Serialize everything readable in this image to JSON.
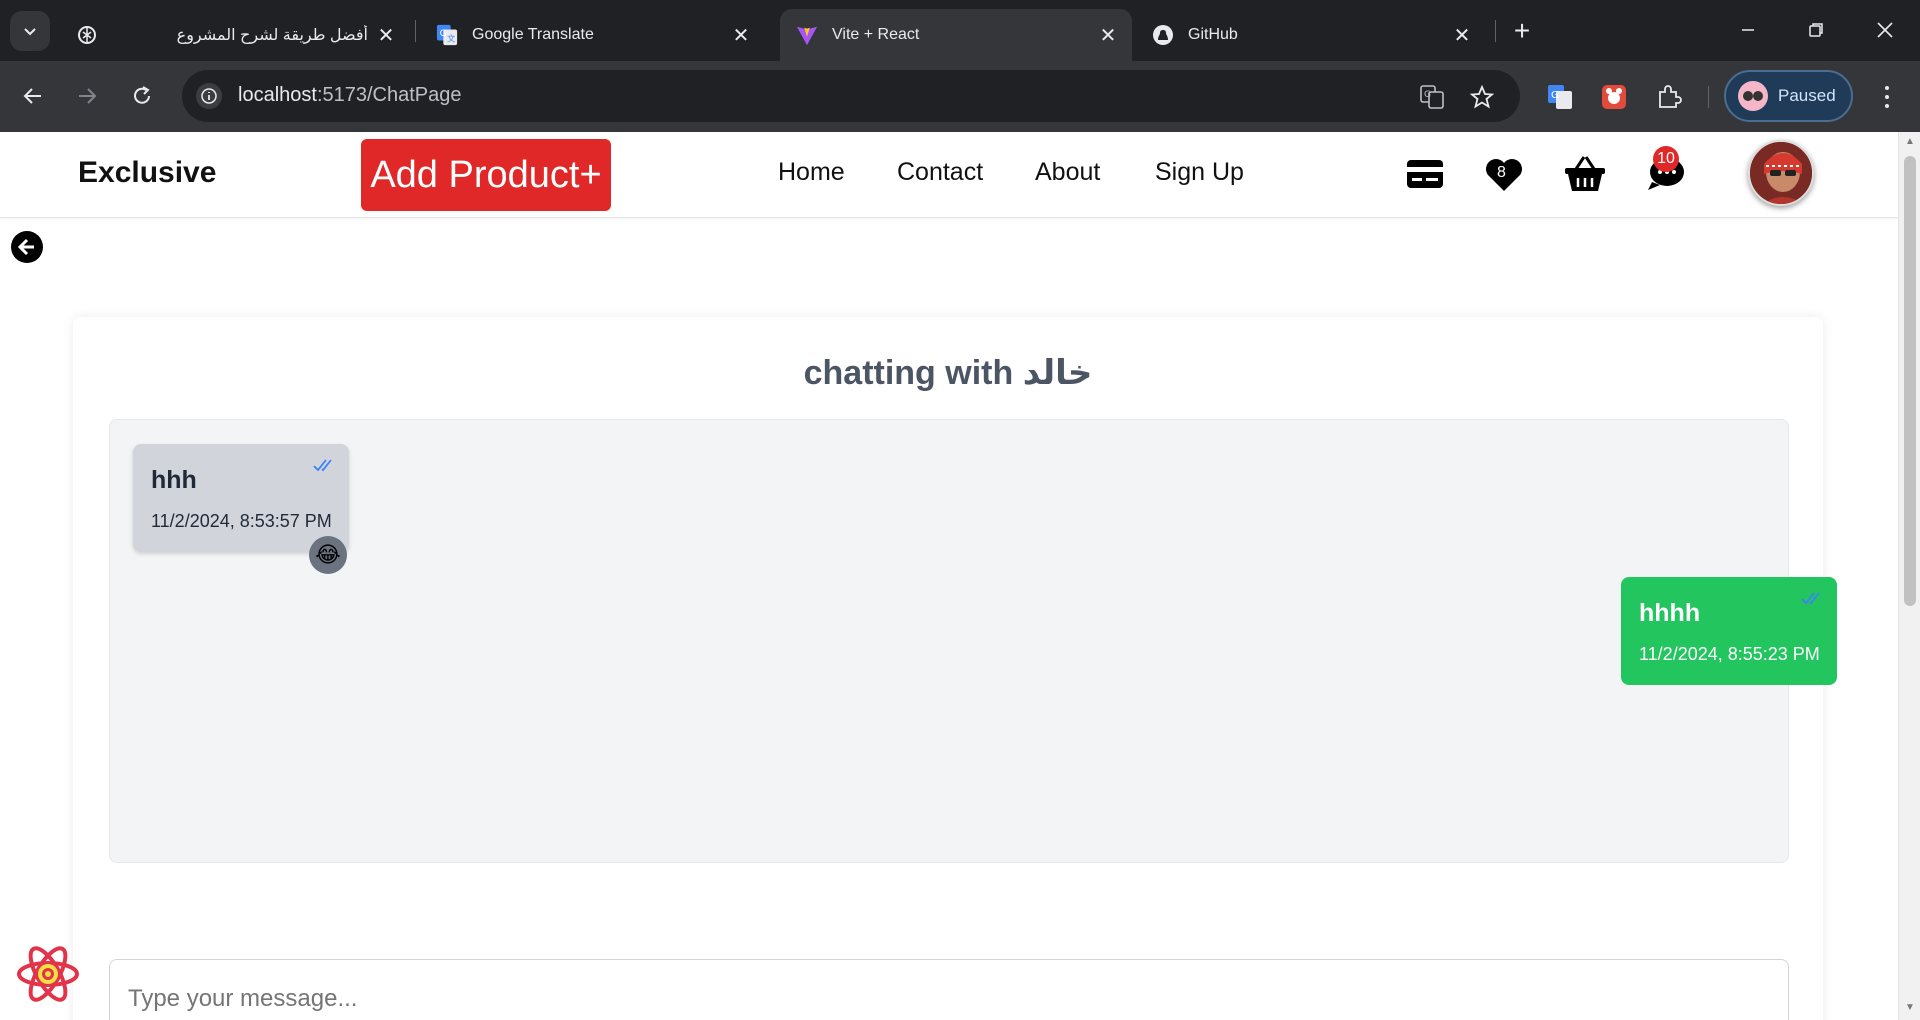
{
  "browser": {
    "tabs": [
      {
        "title": "أفضل طريقة لشرح المشروع",
        "favicon": "chatgpt-icon",
        "active": false
      },
      {
        "title": "Google Translate",
        "favicon": "google-translate-icon",
        "active": false
      },
      {
        "title": "Vite + React",
        "favicon": "vite-icon",
        "active": true
      },
      {
        "title": "GitHub",
        "favicon": "github-icon",
        "active": false
      }
    ],
    "url_host": "localhost",
    "url_path": ":5173/ChatPage",
    "profile_label": "Paused"
  },
  "navbar": {
    "brand": "Exclusive",
    "add_product_label": "Add Product+",
    "links": [
      "Home",
      "Contact",
      "About",
      "Sign Up"
    ],
    "wishlist_count": "8",
    "messages_count": "10",
    "colors": {
      "accent_red": "#e02828"
    }
  },
  "chat": {
    "title": "chatting with خالد",
    "messages": [
      {
        "text": "hhh",
        "time": "11/2/2024, 8:53:57 PM",
        "direction": "incoming",
        "reaction": "😂",
        "color": "#d1d5db"
      },
      {
        "text": "hhhh",
        "time": "11/2/2024, 8:55:23 PM",
        "direction": "outgoing",
        "color": "#22c55e"
      }
    ],
    "input_placeholder": "Type your message..."
  }
}
